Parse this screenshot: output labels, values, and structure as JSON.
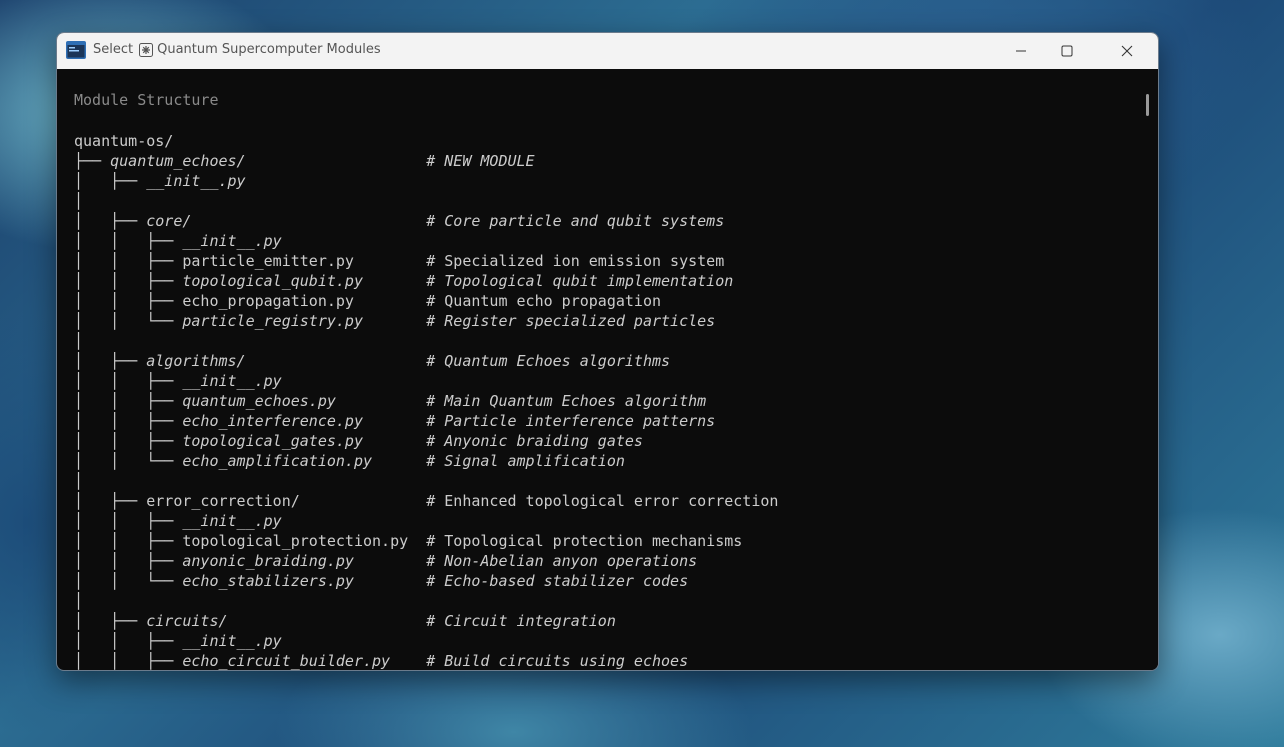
{
  "window": {
    "title_prefix": "Select",
    "title_name": "Quantum Supercomputer Modules",
    "controls": {
      "minimize_icon": "minimize-icon",
      "maximize_icon": "maximize-icon",
      "close_icon": "close-icon"
    }
  },
  "terminal": {
    "heading": "Module Structure",
    "lines": [
      {
        "tree": "quantum-os/",
        "comment": ""
      },
      {
        "tree": "├── quantum_echoes/",
        "comment": "# NEW MODULE"
      },
      {
        "tree": "│   ├── __init__.py",
        "comment": ""
      },
      {
        "tree": "│",
        "comment": ""
      },
      {
        "tree": "│   ├── core/",
        "comment": "# Core particle and qubit systems"
      },
      {
        "tree": "│   │   ├── __init__.py",
        "comment": ""
      },
      {
        "tree": "│   │   ├── particle_emitter.py",
        "comment": "# Specialized ion emission system"
      },
      {
        "tree": "│   │   ├── topological_qubit.py",
        "comment": "# Topological qubit implementation"
      },
      {
        "tree": "│   │   ├── echo_propagation.py",
        "comment": "# Quantum echo propagation"
      },
      {
        "tree": "│   │   └── particle_registry.py",
        "comment": "# Register specialized particles"
      },
      {
        "tree": "│",
        "comment": ""
      },
      {
        "tree": "│   ├── algorithms/",
        "comment": "# Quantum Echoes algorithms"
      },
      {
        "tree": "│   │   ├── __init__.py",
        "comment": ""
      },
      {
        "tree": "│   │   ├── quantum_echoes.py",
        "comment": "# Main Quantum Echoes algorithm"
      },
      {
        "tree": "│   │   ├── echo_interference.py",
        "comment": "# Particle interference patterns"
      },
      {
        "tree": "│   │   ├── topological_gates.py",
        "comment": "# Anyonic braiding gates"
      },
      {
        "tree": "│   │   └── echo_amplification.py",
        "comment": "# Signal amplification"
      },
      {
        "tree": "│",
        "comment": ""
      },
      {
        "tree": "│   ├── error_correction/",
        "comment": "# Enhanced topological error correction"
      },
      {
        "tree": "│   │   ├── __init__.py",
        "comment": ""
      },
      {
        "tree": "│   │   ├── topological_protection.py",
        "comment": "# Topological protection mechanisms"
      },
      {
        "tree": "│   │   ├── anyonic_braiding.py",
        "comment": "# Non-Abelian anyon operations"
      },
      {
        "tree": "│   │   └── echo_stabilizers.py",
        "comment": "# Echo-based stabilizer codes"
      },
      {
        "tree": "│",
        "comment": ""
      },
      {
        "tree": "│   ├── circuits/",
        "comment": "# Circuit integration"
      },
      {
        "tree": "│   │   ├── __init__.py",
        "comment": ""
      },
      {
        "tree": "│   │   ├── echo_circuit_builder.py",
        "comment": "# Build circuits using echoes"
      }
    ],
    "italic_lines": [
      1,
      2,
      4,
      5,
      7,
      9,
      11,
      12,
      13,
      14,
      15,
      16,
      19,
      21,
      22,
      24,
      25,
      26
    ],
    "normal_lines": [
      0,
      3,
      6,
      8,
      10,
      17,
      18,
      20,
      23
    ]
  },
  "colors": {
    "terminal_bg": "#0c0c0c",
    "terminal_text": "#cccccc",
    "heading_text": "#8a8a8a",
    "titlebar_bg": "#f3f3f3"
  }
}
